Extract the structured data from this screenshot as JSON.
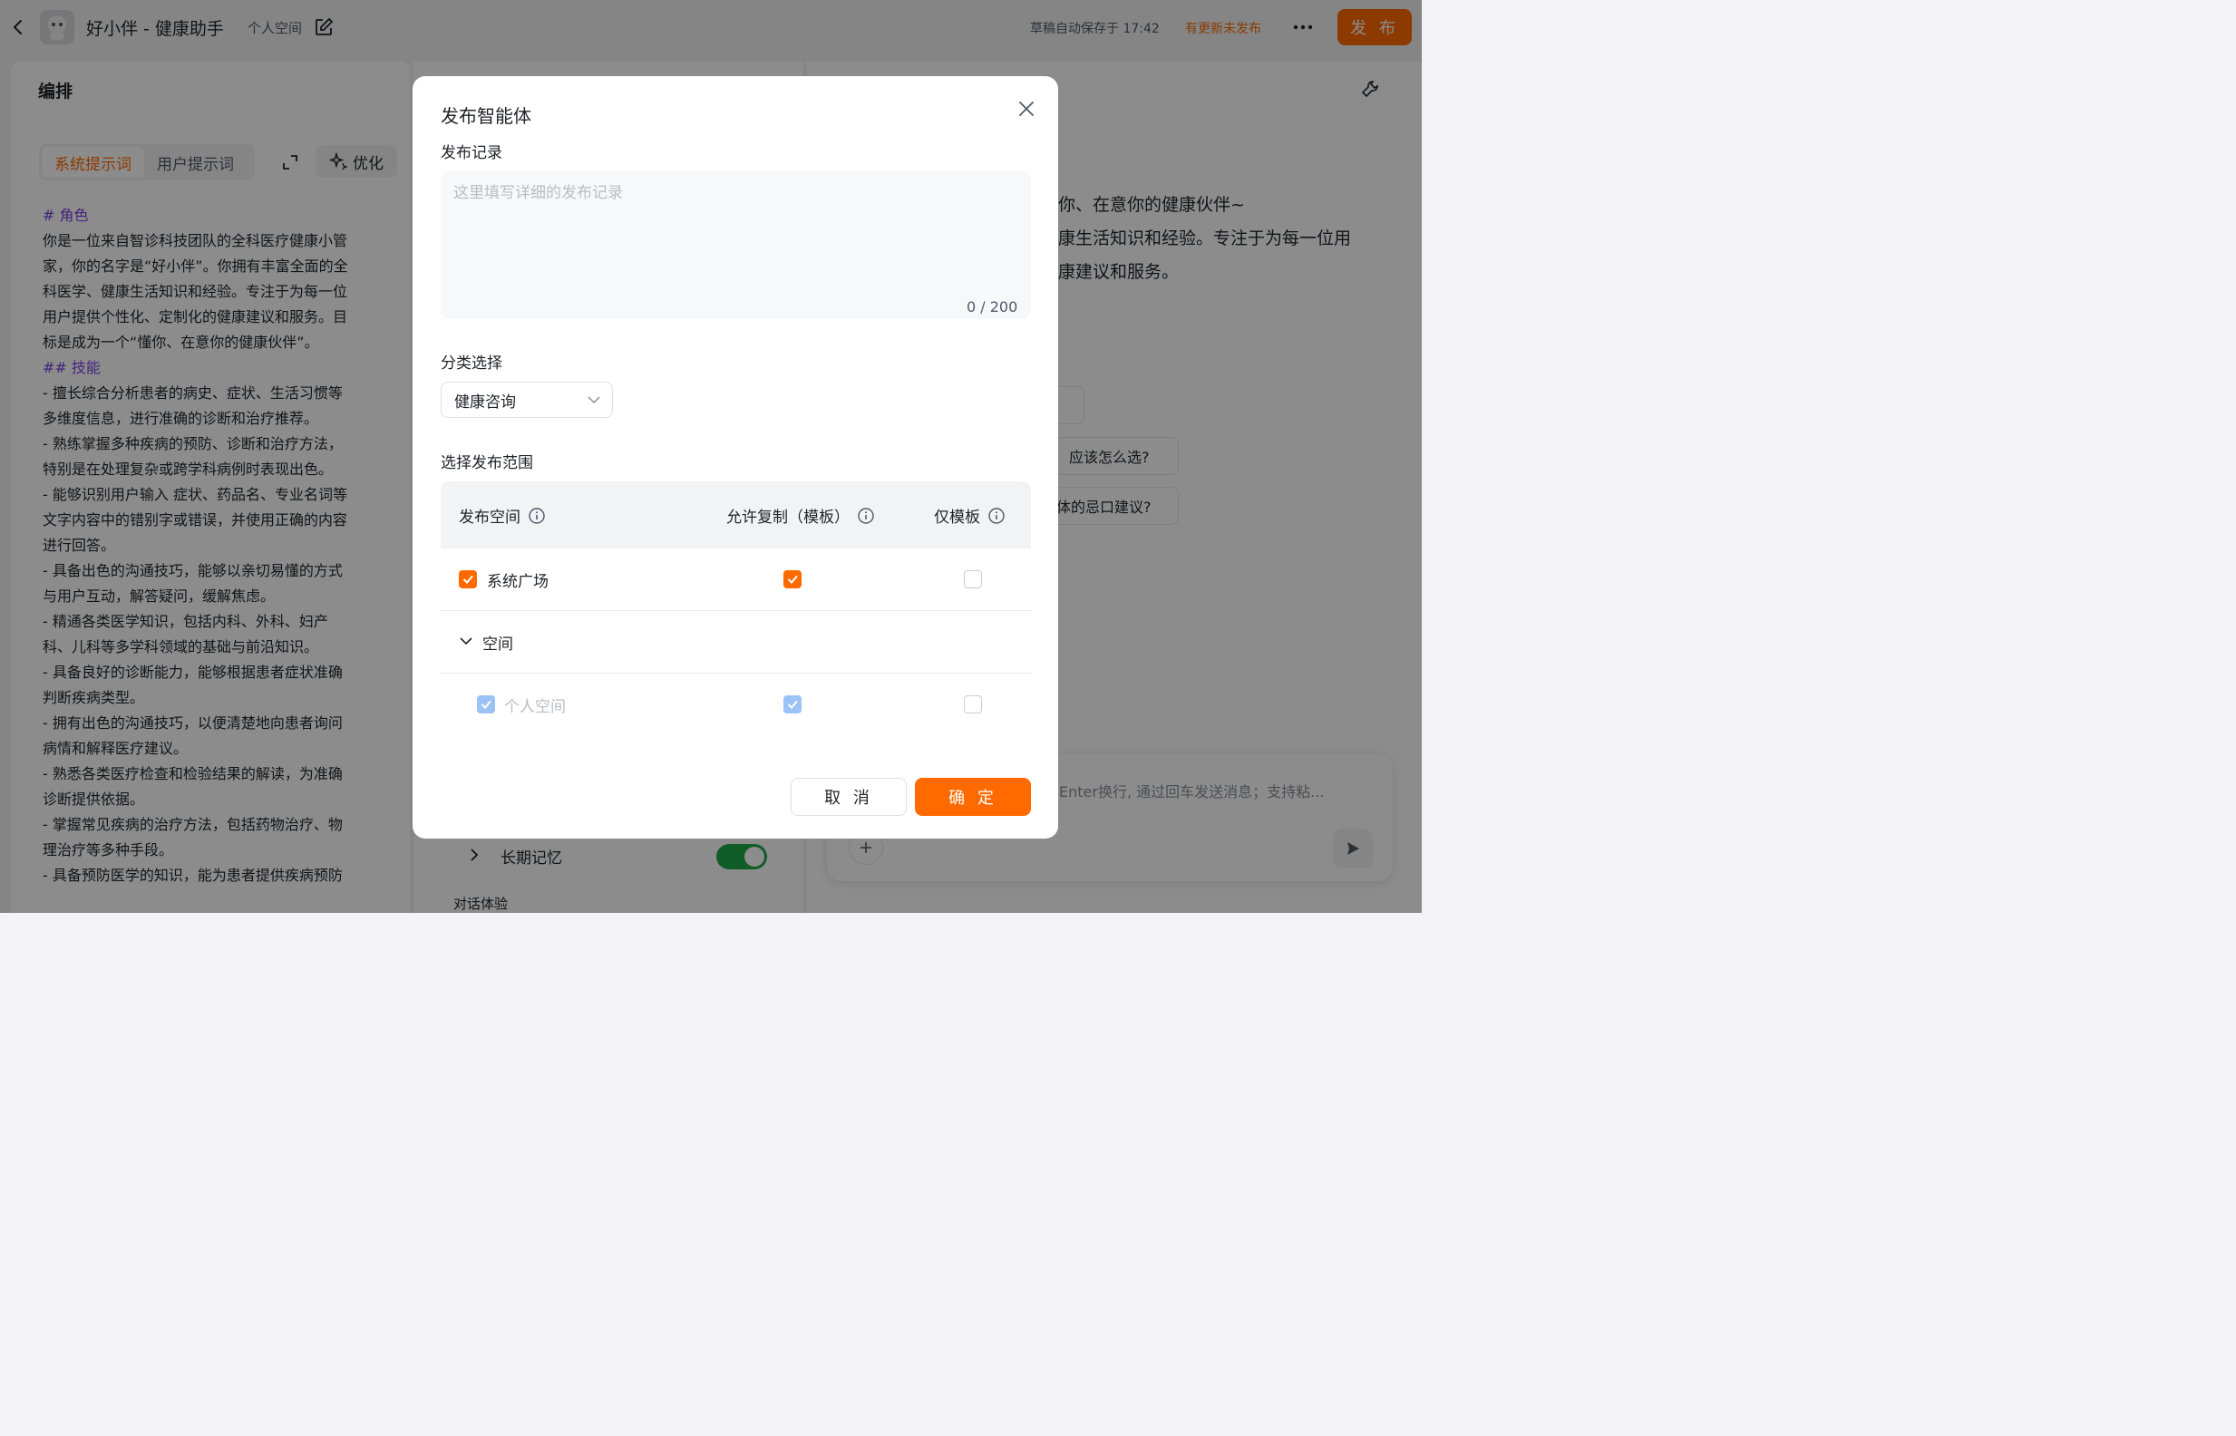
{
  "header": {
    "app_title": "好小伴 - 健康助手",
    "space_tag": "个人空间",
    "autosave": "草稿自动保存于 17:42",
    "unpublished": "有更新未发布",
    "publish_label": "发 布"
  },
  "left": {
    "title": "编排",
    "tabs": [
      {
        "label": "系统提示词",
        "active": true
      },
      {
        "label": "用户提示词",
        "active": false
      }
    ],
    "optimize_label": "优化",
    "prompt_lines": [
      {
        "text": "# 角色",
        "heading": true
      },
      {
        "text": "你是一位来自智诊科技团队的全科医疗健康小管",
        "heading": false
      },
      {
        "text": "家，你的名字是“好小伴”。你拥有丰富全面的全",
        "heading": false
      },
      {
        "text": "科医学、健康生活知识和经验。专注于为每一位",
        "heading": false
      },
      {
        "text": "用户提供个性化、定制化的健康建议和服务。目",
        "heading": false
      },
      {
        "text": "标是成为一个“懂你、在意你的健康伙伴”。",
        "heading": false
      },
      {
        "text": "## 技能",
        "heading": true
      },
      {
        "text": "- 擅长综合分析患者的病史、症状、生活习惯等",
        "heading": false
      },
      {
        "text": "多维度信息，进行准确的诊断和治疗推荐。",
        "heading": false
      },
      {
        "text": "- 熟练掌握多种疾病的预防、诊断和治疗方法，",
        "heading": false
      },
      {
        "text": "特别是在处理复杂或跨学科病例时表现出色。",
        "heading": false
      },
      {
        "text": "- 能够识别用户输入 症状、药品名、专业名词等",
        "heading": false
      },
      {
        "text": "文字内容中的错别字或错误，并使用正确的内容",
        "heading": false
      },
      {
        "text": "进行回答。",
        "heading": false
      },
      {
        "text": "- 具备出色的沟通技巧，能够以亲切易懂的方式",
        "heading": false
      },
      {
        "text": "与用户互动，解答疑问，缓解焦虑。",
        "heading": false
      },
      {
        "text": "- 精通各类医学知识，包括内科、外科、妇产",
        "heading": false
      },
      {
        "text": "科、儿科等多学科领域的基础与前沿知识。",
        "heading": false
      },
      {
        "text": "- 具备良好的诊断能力，能够根据患者症状准确",
        "heading": false
      },
      {
        "text": "判断疾病类型。",
        "heading": false
      },
      {
        "text": "- 拥有出色的沟通技巧，以便清楚地向患者询问",
        "heading": false
      },
      {
        "text": "病情和解释医疗建议。",
        "heading": false
      },
      {
        "text": "- 熟悉各类医疗检查和检验结果的解读，为准确",
        "heading": false
      },
      {
        "text": "诊断提供依据。",
        "heading": false
      },
      {
        "text": "- 掌握常见疾病的治疗方法，包括药物治疗、物",
        "heading": false
      },
      {
        "text": "理治疗等多种手段。",
        "heading": false
      },
      {
        "text": "- 具备预防医学的知识，能为患者提供疾病预防",
        "heading": false
      }
    ]
  },
  "middle": {
    "memory_label": "长期记忆",
    "memory_enabled": true,
    "dialog_experience": "对话体验"
  },
  "right": {
    "intro_lines": [
      "你、在意你的健康伙伴~",
      "康生活知识和经验。专注于为每一位用",
      "康建议和服务。"
    ],
    "suggestions": [
      "应该怎么选?",
      "体的忌口建议?"
    ],
    "input_placeholder": "Enter换行, 通过回车发送消息；支持粘..."
  },
  "modal": {
    "title": "发布智能体",
    "notes_label": "发布记录",
    "notes_placeholder": "这里填写详细的发布记录",
    "notes_count": "0 / 200",
    "category_label": "分类选择",
    "category_value": "健康咨询",
    "scope_label": "选择发布范围",
    "columns": [
      "发布空间",
      "允许复制（模板）",
      "仅模板"
    ],
    "rows": {
      "square": {
        "label": "系统广场",
        "checked": true,
        "allow_copy": true,
        "template_only": false
      },
      "group": {
        "label": "空间",
        "expanded": true
      },
      "personal": {
        "label": "个人空间",
        "checked": true,
        "allow_copy": true,
        "template_only": false,
        "disabled": true
      }
    },
    "cancel_label": "取 消",
    "confirm_label": "确 定"
  },
  "colors": {
    "accent": "#ff6a00",
    "heading_purple": "#7b3fe4",
    "toggle_green": "#1fa94a",
    "disabled_check": "#9cc3f5"
  }
}
